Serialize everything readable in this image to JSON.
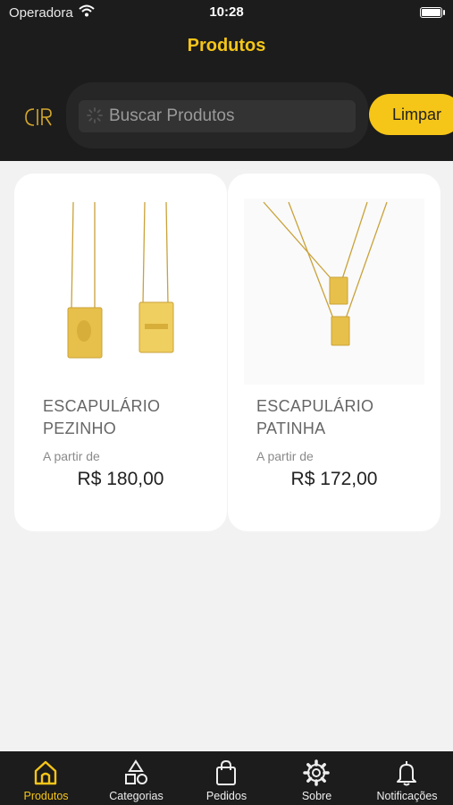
{
  "status_bar": {
    "carrier": "Operadora",
    "time": "10:28"
  },
  "header": {
    "title": "Produtos"
  },
  "search": {
    "placeholder": "Buscar Produtos",
    "clear_label": "Limpar"
  },
  "products": [
    {
      "name": "ESCAPULÁRIO PEZINHO",
      "price_prefix": "A partir de",
      "price": "R$ 180,00"
    },
    {
      "name": "ESCAPULÁRIO PATINHA",
      "price_prefix": "A partir de",
      "price": "R$ 172,00"
    }
  ],
  "tabbar": {
    "items": [
      {
        "label": "Produtos",
        "icon": "home-icon",
        "active": true
      },
      {
        "label": "Categorias",
        "icon": "shapes-icon"
      },
      {
        "label": "Pedidos",
        "icon": "shopping-bag-icon"
      },
      {
        "label": "Sobre",
        "icon": "gear-icon"
      },
      {
        "label": "Notificações",
        "icon": "bell-icon"
      }
    ]
  },
  "colors": {
    "accent": "#f5c518",
    "header_bg": "#1c1c1c",
    "page_bg": "#f2f2f2"
  }
}
